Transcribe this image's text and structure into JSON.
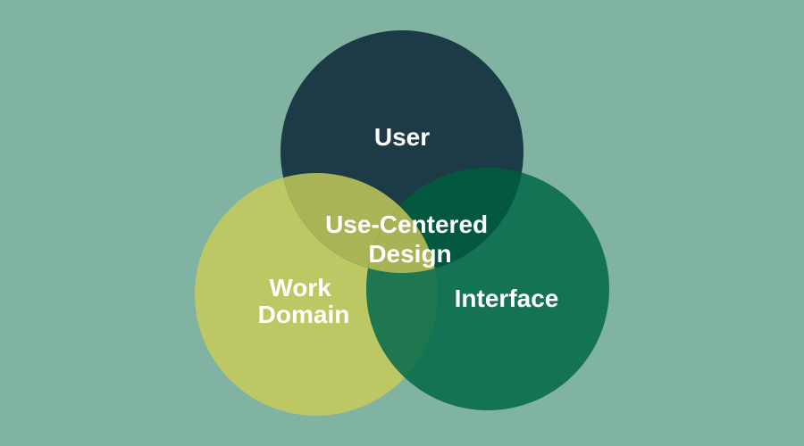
{
  "background_color": "#80b3a1",
  "sets": [
    {
      "id": "user",
      "label": "User",
      "color": "#1c3b47"
    },
    {
      "id": "work_domain",
      "label_lines": [
        "Work",
        "Domain"
      ],
      "color": "#bdc865"
    },
    {
      "id": "interface",
      "label": "Interface",
      "color": "#157355"
    }
  ],
  "overlap_colors": {
    "user_work_domain": "#a9b457",
    "user_interface": "#03583f",
    "work_domain_interface": "#1e774e",
    "all_three": "#a8b356"
  },
  "center": {
    "label_lines": [
      "Use-Centered",
      "Design"
    ]
  }
}
